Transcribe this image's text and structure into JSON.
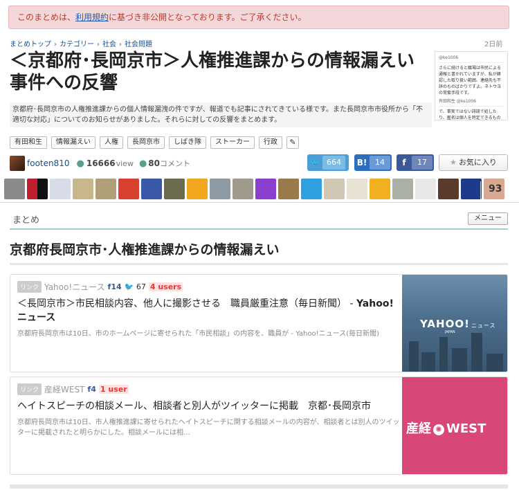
{
  "notice": {
    "before": "このまとめは、",
    "link": "利用規約",
    "after": "に基づき非公開となっております。ご了承ください。"
  },
  "breadcrumb": [
    "まとめトップ",
    "カテゴリー",
    "社会",
    "社会問題"
  ],
  "breadcrumb_sep": "›",
  "date": "2日前",
  "title": "＜京都府･長岡京市＞人権推進課からの情報漏えい事件への反響",
  "thumb": {
    "handle": "@ke1006",
    "text": "さらに続けると職場は市民による通報と書かれていますが、私が確認した取り扱い範囲、連絡先も不詳のものばかりですよ。ネトウヨの常套手段です。",
    "handle2": "有田和生 @ke1006",
    "text2": "で、事実ではない誹謗で処したり、匿名は個人を特定できるものではないとして"
  },
  "description": "京都府･長岡京市の人権推進課からの個人情報漏洩の件ですが、報道でも記事にされてきている様です。また長岡京市市役所から「不適切な対応」についてのお知らせがありました。それらに対しての反響をまとめます。",
  "tags": [
    "有田和生",
    "情報漏えい",
    "人権",
    "長岡京市",
    "しばき隊",
    "ストーカー",
    "行政"
  ],
  "author": {
    "name": "footen810",
    "views": "16666",
    "views_label": "view",
    "comments": "80",
    "comments_label": "コメント"
  },
  "share": {
    "twitter": "664",
    "hatena": "14",
    "facebook": "17"
  },
  "favorite_label": "お気に入り",
  "favorites_total": "93",
  "matome_label": "まとめ",
  "menu_label": "メニュー",
  "section_title": "京都府長岡京市･人権推進課からの情報漏えい",
  "cards": [
    {
      "badge": "リンク",
      "source": "Yahoo!ニュース",
      "fb": "14",
      "tw": "67",
      "users": "4 users",
      "title": "＜長岡京市＞市民相談内容、他人に撮影させる　職員厳重注意（毎日新聞） - ",
      "title_bold": "Yahoo!ニュース",
      "desc": "京都府長岡京市は10日、市のホームページに寄せられた「市民相談」の内容を、職員が - Yahoo!ニュース(毎日新聞)",
      "img_logo": "YAHOO!",
      "img_logo_sub": "ニュース",
      "img_sub": "JAPAN"
    },
    {
      "badge": "リンク",
      "source": "産経WEST",
      "fb": "4",
      "users": "1 user",
      "title": "ヘイトスピーチの相談メール、相談者と別人がツイッターに掲載　京都･長岡京市",
      "desc": "京都府長岡京市は10日、市人権推進課に寄せられたヘイトスピーチに関する相談メールの内容が、相談者とは別人のツイッターに掲載されたと明らかにした。相談メールには相…",
      "img_logo_left": "産経",
      "img_logo_right": "WEST"
    }
  ],
  "colors": {
    "twitter": "#4a9fd8",
    "hatena": "#2c6ebd",
    "facebook": "#3b5998",
    "sankei": "#d9467a",
    "notice_bg": "#f4d7da"
  }
}
